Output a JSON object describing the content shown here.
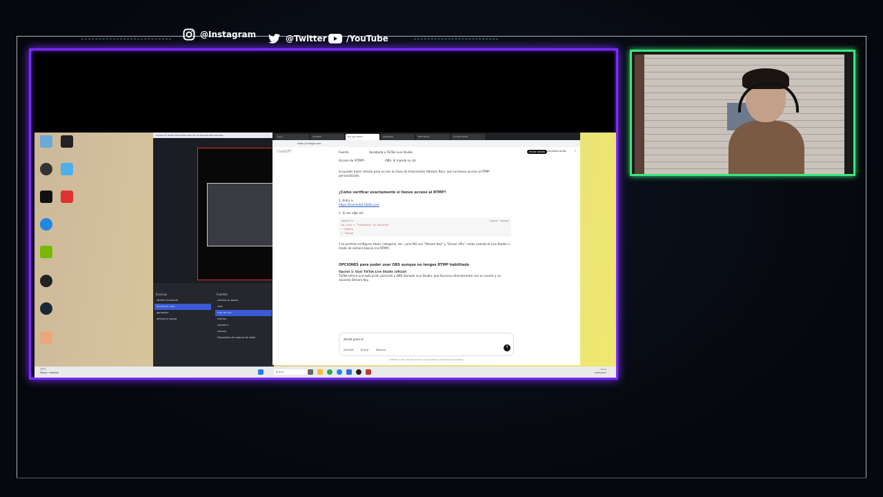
{
  "overlay": {
    "instagram": "@Instagram",
    "twitter": "@Twitter",
    "youtube": "/YouTube",
    "colors": {
      "frame": "#7b2cff",
      "camera": "#3ee67d",
      "accent": "#4fd1b7"
    }
  },
  "obs": {
    "menu": "Archivo (F)  Editar  Vista  Perfil  Colección de escenas  Herramientas",
    "scenes_header": "Escenas",
    "sources_header": "Fuentes",
    "scenes": [
      "stream charlando",
      "directo en vivo",
      "gameplay",
      "directo en pausa"
    ],
    "sources": [
      "camara en pausa",
      "chat",
      "chat de voz",
      "overlay",
      "camara 2",
      "camara",
      "Dispositivo de captura de vídeo"
    ]
  },
  "browser": {
    "url": "https://chatgpt.com",
    "tabs": [
      "Inicio",
      "ChatGPT",
      "Por qué TikTok",
      "WhatsApp",
      "OBS Studio",
      "YouTube Music"
    ],
    "chat": {
      "logo": "ChatGPT",
      "login": "Iniciar sesión",
      "register": "Suscríbete gratis",
      "help": "?",
      "row1_left": "Fuente",
      "row1_right": "Aprobada a TikTok Live Studio",
      "row2_left": "Acceso de (RTMP)",
      "row2_right": "OBS. Si manda su clic",
      "para1": "Si puedes hacer directo pero no ves la clave de transmisión (Stream Key), aún no tienes acceso al RTMP personalizado.",
      "heading1": "¿Cómo verificar exactamente si tienes acceso al RTMP?",
      "step1": "1. Entra a:",
      "link": "https://livecenter.tiktok.com",
      "step2": "2. Si ves algo así:",
      "code_lang": "makefile",
      "code_copy": "Copiar código",
      "code_lines": [
        "Go Live  >  \"Transmitir en directo\"",
        "> Cámara",
        "> Tiktok"
      ],
      "para2": "Y te permite configurar título, categoría, etc., pero NO ves \"Stream Key\" y \"Server URL\", estás usando el Live Studio o modo de cámara básica (no RTMP).",
      "heading2": "OPCIONES para poder usar OBS aunque no tengas RTMP habilitado",
      "option1": "Opción 1: Usar TikTok Live Studio (oficial)",
      "para3": "TikTok ofrece una aplicación parecida a OBS llamada Live Studio, que funciona directamente con tu cuenta y no necesita Stream Key.",
      "input_placeholder": "donde pone id",
      "attach": "Adjuntar",
      "search": "Buscar",
      "reason": "Razonar",
      "footer": "ChatGPT puede cometer errores. Comprueba la información importante."
    }
  },
  "taskbar": {
    "search": "Buscar",
    "weather": "17°C",
    "weather_sub": "Mayor. nublado",
    "time": "17:31",
    "date": "26/06/2025"
  }
}
